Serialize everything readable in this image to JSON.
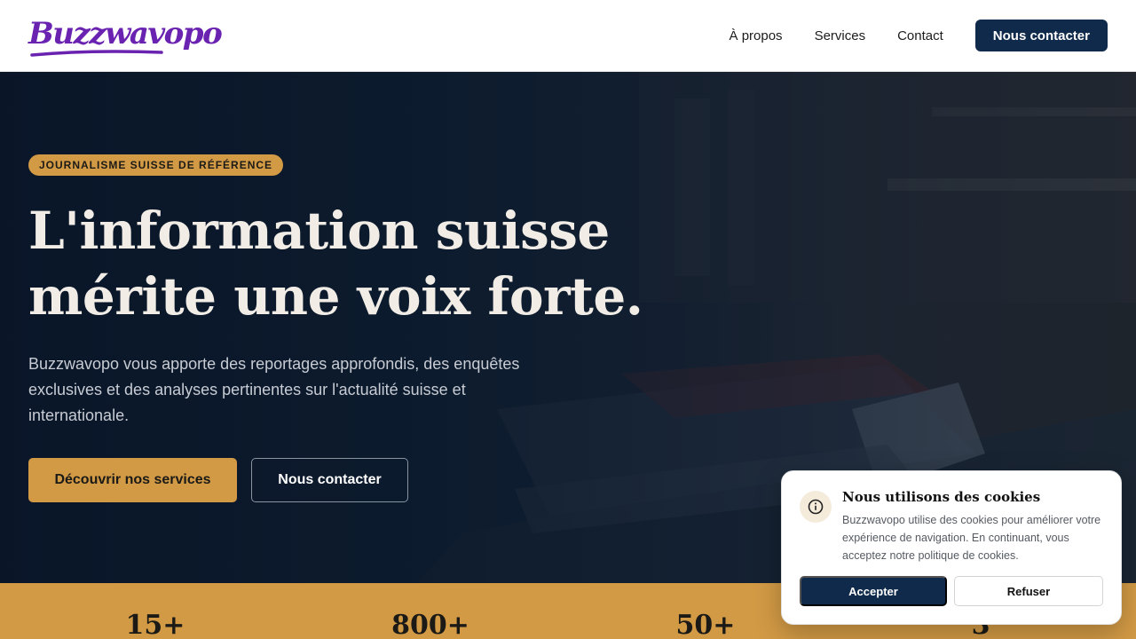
{
  "brand": {
    "name": "Buzzwavopo",
    "color": "#6a22b0"
  },
  "nav": {
    "links": [
      "À propos",
      "Services",
      "Contact"
    ],
    "cta": "Nous contacter"
  },
  "hero": {
    "badge": "JOURNALISME SUISSE DE RÉFÉRENCE",
    "title_line1": "L'information suisse",
    "title_line2": "mérite une voix forte.",
    "text": "Buzzwavopo vous apporte des reportages approfondis, des enquêtes exclusives et des analyses pertinentes sur l'actualité suisse et internationale.",
    "primary_button": "Découvrir nos services",
    "secondary_button": "Nous contacter"
  },
  "stats": {
    "values": [
      "15+",
      "800+",
      "50+",
      "3"
    ]
  },
  "cookie": {
    "icon": "info-icon",
    "title": "Nous utilisons des cookies",
    "text": "Buzzwavopo utilise des cookies pour améliorer votre expérience de navigation. En continuant, vous acceptez notre politique de cookies.",
    "accept": "Accepter",
    "refuse": "Refuser"
  },
  "colors": {
    "navy": "#0f2a4a",
    "gold": "#d29a45",
    "hero_bg": "#0b1a2e"
  }
}
